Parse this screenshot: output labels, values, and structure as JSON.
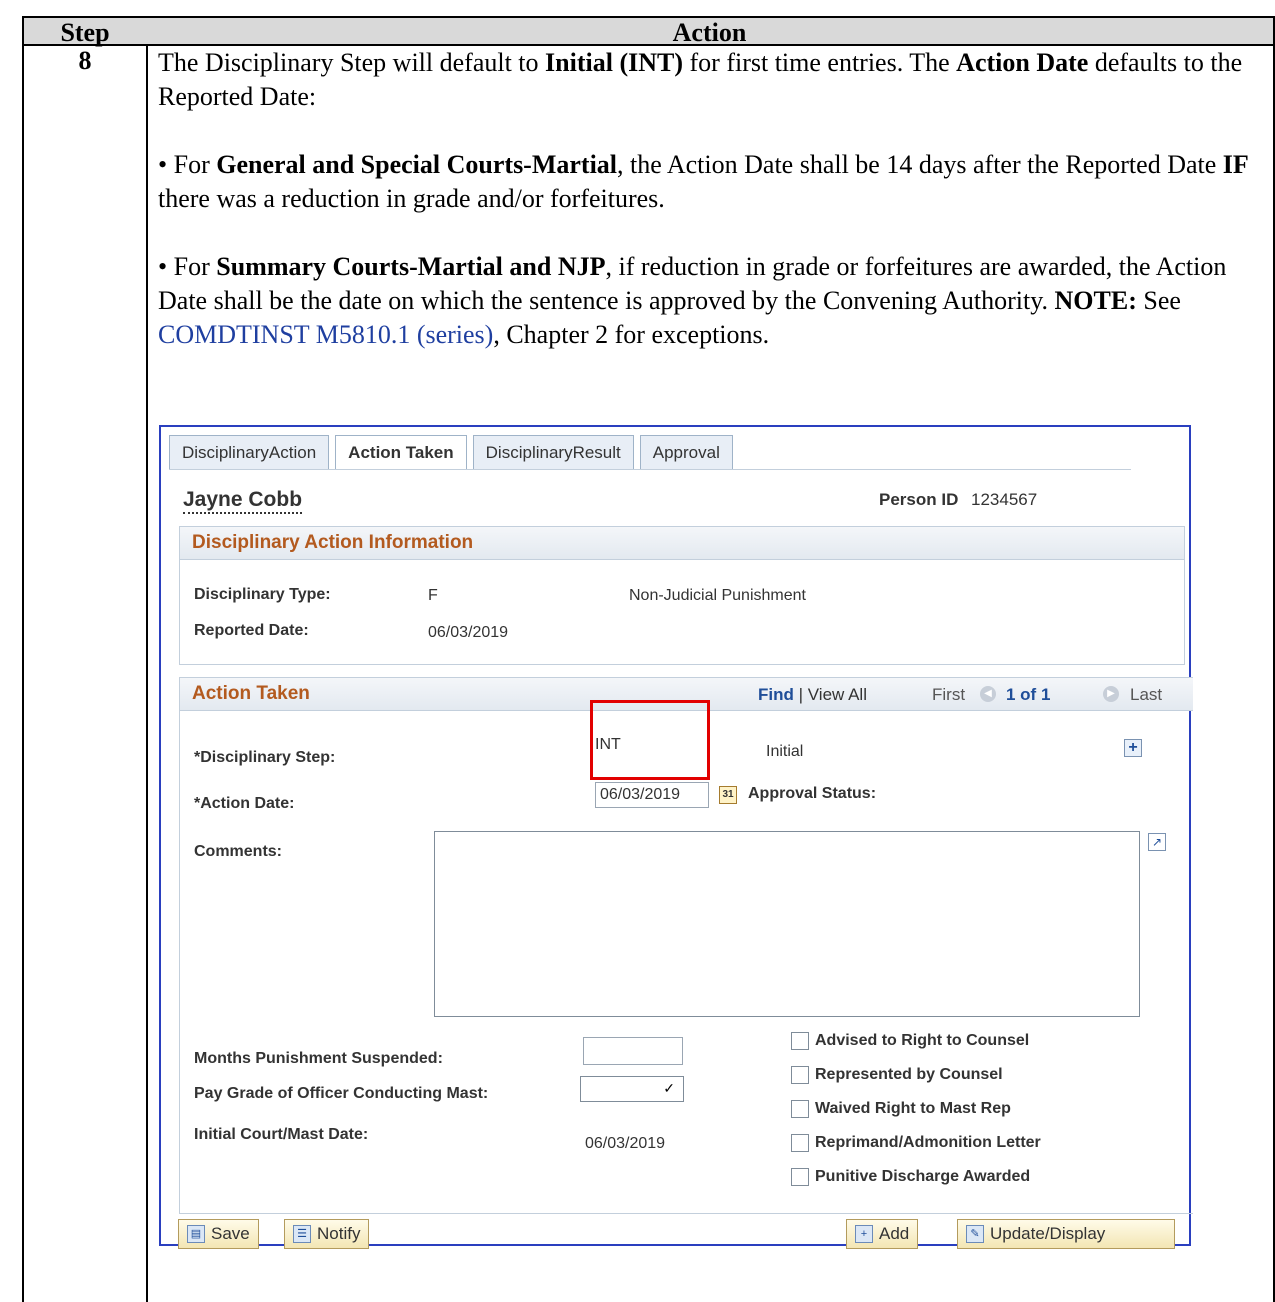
{
  "table": {
    "header_step": "Step",
    "header_action": "Action",
    "step_number": "8"
  },
  "instructions": {
    "p1_a": "The Disciplinary Step will default to ",
    "p1_b": "Initial (INT)",
    "p1_c": " for first time entries.  The ",
    "p1_d": "Action Date",
    "p1_e": " defaults to the Reported Date:",
    "b1_a": "For ",
    "b1_b": "General and Special Courts-Martial",
    "b1_c": ", the Action Date shall be 14 days after the Reported Date ",
    "b1_d": "IF",
    "b1_e": " there was a reduction in grade and/or forfeitures.",
    "b2_a": "For ",
    "b2_b": "Summary Courts-Martial and NJP",
    "b2_c": ", if reduction in grade or forfeitures are awarded, the Action Date shall be the date on which the sentence is approved by the Convening Authority.  ",
    "b2_d": "NOTE:",
    "b2_e": "  See ",
    "b2_link": "COMDTINST M5810.1 (series)",
    "b2_f": ", Chapter 2 for exceptions."
  },
  "ui": {
    "tabs": [
      "DisciplinaryAction",
      "Action Taken",
      "DisciplinaryResult",
      "Approval"
    ],
    "person_name": "Jayne Cobb",
    "person_id_label": "Person ID",
    "person_id_value": "1234567",
    "info_section": {
      "title": "Disciplinary Action Information",
      "type_label": "Disciplinary Type:",
      "type_code": "F",
      "type_desc": "Non-Judicial Punishment",
      "reported_label": "Reported Date:",
      "reported_value": "06/03/2019"
    },
    "action_section": {
      "title": "Action Taken",
      "find": "Find",
      "sep": " | ",
      "view_all": "View All",
      "first": "First",
      "count": "1 of 1",
      "last": "Last",
      "step_label": "*Disciplinary Step:",
      "step_value": "INT",
      "step_desc": "Initial",
      "date_label": "*Action Date:",
      "date_value": "06/03/2019",
      "approval_label": "Approval Status:",
      "comments_label": "Comments:",
      "months_label": "Months Punishment Suspended:",
      "paygrade_label": "Pay Grade of Officer Conducting Mast:",
      "initial_label": "Initial Court/Mast Date:",
      "initial_value": "06/03/2019",
      "checkboxes": [
        "Advised to Right to Counsel",
        "Represented by Counsel",
        "Waived Right to Mast Rep",
        "Reprimand/Admonition Letter",
        "Punitive Discharge Awarded"
      ]
    },
    "buttons": {
      "save": "Save",
      "notify": "Notify",
      "add": "Add",
      "update": "Update/Display"
    },
    "icons": {
      "calendar": "31",
      "plus": "+",
      "expand": "↗"
    }
  }
}
